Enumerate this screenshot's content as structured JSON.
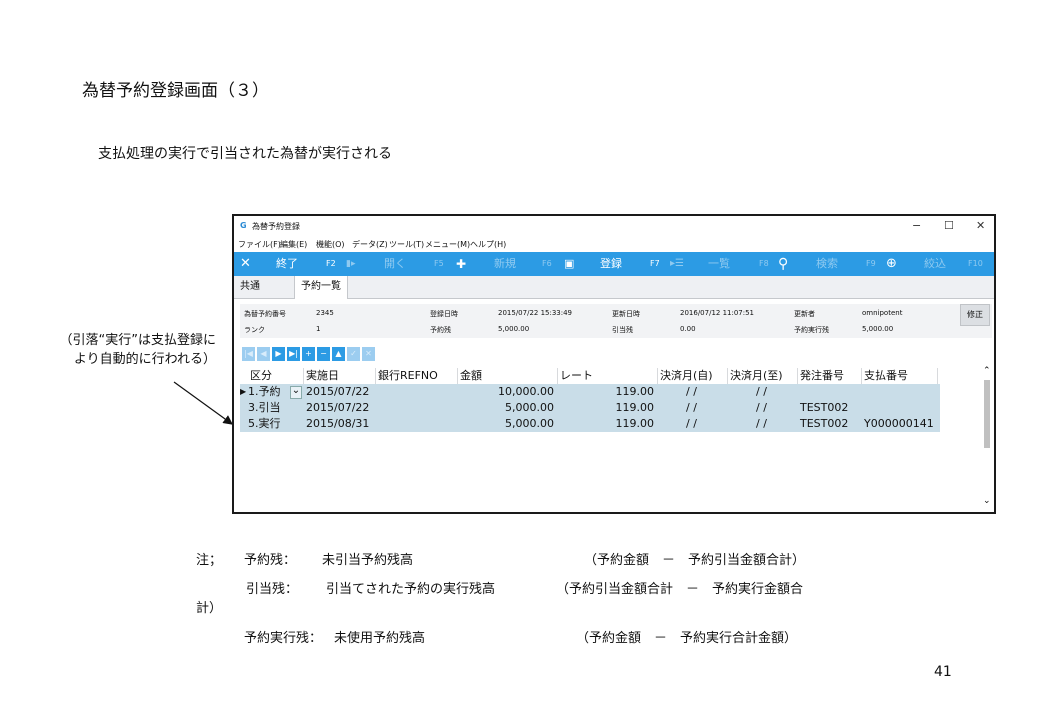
{
  "slide": {
    "title": "為替予約登録画面（３）",
    "subtitle": "支払処理の実行で引当された為替が実行される",
    "callout_line1": "（引落“実行”は支払登録に",
    "callout_line2": "より自動的に行われる）",
    "page_number": "41"
  },
  "window": {
    "app_icon": "G",
    "title": "為替予約登録",
    "minimize": "−",
    "maximize": "☐",
    "close": "✕"
  },
  "menu": {
    "file": "ファイル(F)",
    "edit": "編集(E)",
    "function": "機能(O)",
    "data": "データ(Z)",
    "tools": "ツール(T)",
    "menu": "メニュー(M)",
    "help": "ヘルプ(H)"
  },
  "toolbar": {
    "exit_icon": "✕",
    "exit": "終了",
    "f2": "F2",
    "open_icon": "▮▸",
    "open": "開く",
    "f5": "F5",
    "new_icon": "✚",
    "new": "新規",
    "f6": "F6",
    "register_icon": "▣",
    "register": "登録",
    "f7": "F7",
    "list_icon": "▸☰",
    "list": "一覧",
    "f8": "F8",
    "search_icon": "⚲",
    "search": "検索",
    "f9": "F9",
    "filter_icon": "⊕",
    "filter": "絞込",
    "f10": "F10"
  },
  "tabs": [
    "共通",
    "予約一覧"
  ],
  "info": {
    "reserve_no_label": "為替予約番号",
    "reserve_no": "2345",
    "registered_label": "登録日時",
    "registered": "2015/07/22 15:33:49",
    "updated_label": "更新日時",
    "updated": "2016/07/12 11:07:51",
    "updater_label": "更新者",
    "updater": "omnipotent",
    "rank_label": "ランク",
    "rank": "1",
    "remaining_label": "予約残",
    "remaining": "5,000.00",
    "allocated_label": "引当残",
    "allocated": "0.00",
    "exec_remaining_label": "予約実行残",
    "exec_remaining": "5,000.00",
    "edit_button": "修正"
  },
  "nav": {
    "first": "|◀",
    "prev": "◀",
    "next": "▶",
    "last": "▶|",
    "add": "+",
    "remove": "−",
    "up": "▲",
    "confirm": "✓",
    "cancel": "✕"
  },
  "grid": {
    "headers": [
      "区分",
      "実施日",
      "銀行REFNO",
      "金額",
      "レート",
      "決済月(自)",
      "決済月(至)",
      "発注番号",
      "支払番号"
    ],
    "rows": [
      {
        "marker": "▶",
        "kubun": "1.予約",
        "date": "2015/07/22",
        "ref": "",
        "amount": "10,000.00",
        "rate": "119.00",
        "from": "/  /",
        "to": "/  /",
        "order": "",
        "payment": ""
      },
      {
        "marker": "",
        "kubun": "3.引当",
        "date": "2015/07/22",
        "ref": "",
        "amount": "5,000.00",
        "rate": "119.00",
        "from": "/  /",
        "to": "/  /",
        "order": "TEST002",
        "payment": ""
      },
      {
        "marker": "",
        "kubun": "5.実行",
        "date": "2015/08/31",
        "ref": "",
        "amount": "5,000.00",
        "rate": "119.00",
        "from": "/  /",
        "to": "/  /",
        "order": "TEST002",
        "payment": "Y000000141"
      }
    ],
    "dropdown_icon": "⌄",
    "scroll_up": "⌃",
    "scroll_down": "⌄"
  },
  "notes": {
    "prefix": "注；",
    "line1_term": "予約残：",
    "line1_desc": "未引当予約残高",
    "line1_formula": "（予約金額　－　予約引当金額合計）",
    "line2_term": "引当残：",
    "line2_desc": "引当てされた予約の実行残高",
    "line2_formula": "（予約引当金額合計　－　予約実行金額合",
    "line2_wrap": "計）",
    "line3_term": "予約実行残：",
    "line3_desc": "未使用予約残高",
    "line3_formula": "（予約金額　－　予約実行合計金額）"
  }
}
